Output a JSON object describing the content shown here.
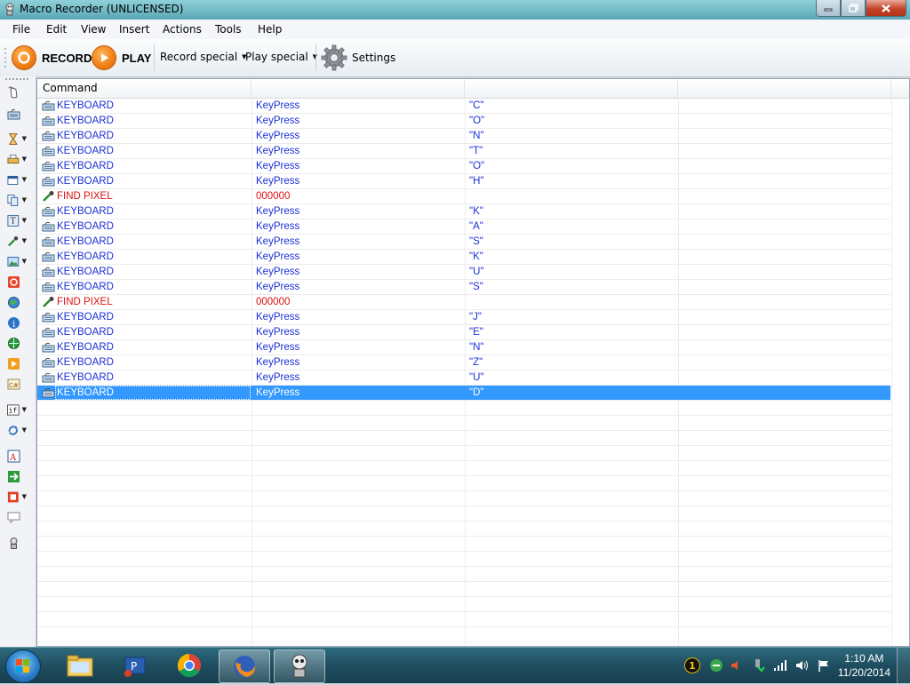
{
  "window": {
    "title": "Macro Recorder (UNLICENSED)"
  },
  "menu": [
    "File",
    "Edit",
    "View",
    "Insert",
    "Actions",
    "Tools",
    "Help"
  ],
  "toolbar": {
    "record_label": "RECORD",
    "play_label": "PLAY",
    "record_special_label": "Record special",
    "play_special_label": "Play special",
    "settings_label": "Settings"
  },
  "grid": {
    "header": {
      "command": "Command",
      "col2": "",
      "col3": "",
      "col4": ""
    },
    "rows": [
      {
        "type": "keyboard",
        "command": "KEYBOARD",
        "action": "KeyPress",
        "value": "\"C\""
      },
      {
        "type": "keyboard",
        "command": "KEYBOARD",
        "action": "KeyPress",
        "value": "\"O\""
      },
      {
        "type": "keyboard",
        "command": "KEYBOARD",
        "action": "KeyPress",
        "value": "\"N\""
      },
      {
        "type": "keyboard",
        "command": "KEYBOARD",
        "action": "KeyPress",
        "value": "\"T\""
      },
      {
        "type": "keyboard",
        "command": "KEYBOARD",
        "action": "KeyPress",
        "value": "\"O\""
      },
      {
        "type": "keyboard",
        "command": "KEYBOARD",
        "action": "KeyPress",
        "value": "\"H\""
      },
      {
        "type": "findpixel",
        "command": "FIND PIXEL",
        "action": "000000",
        "value": ""
      },
      {
        "type": "keyboard",
        "command": "KEYBOARD",
        "action": "KeyPress",
        "value": "\"K\""
      },
      {
        "type": "keyboard",
        "command": "KEYBOARD",
        "action": "KeyPress",
        "value": "\"A\""
      },
      {
        "type": "keyboard",
        "command": "KEYBOARD",
        "action": "KeyPress",
        "value": "\"S\""
      },
      {
        "type": "keyboard",
        "command": "KEYBOARD",
        "action": "KeyPress",
        "value": "\"K\""
      },
      {
        "type": "keyboard",
        "command": "KEYBOARD",
        "action": "KeyPress",
        "value": "\"U\""
      },
      {
        "type": "keyboard",
        "command": "KEYBOARD",
        "action": "KeyPress",
        "value": "\"S\""
      },
      {
        "type": "findpixel",
        "command": "FIND PIXEL",
        "action": "000000",
        "value": ""
      },
      {
        "type": "keyboard",
        "command": "KEYBOARD",
        "action": "KeyPress",
        "value": "\"J\""
      },
      {
        "type": "keyboard",
        "command": "KEYBOARD",
        "action": "KeyPress",
        "value": "\"E\""
      },
      {
        "type": "keyboard",
        "command": "KEYBOARD",
        "action": "KeyPress",
        "value": "\"N\""
      },
      {
        "type": "keyboard",
        "command": "KEYBOARD",
        "action": "KeyPress",
        "value": "\"Z\""
      },
      {
        "type": "keyboard",
        "command": "KEYBOARD",
        "action": "KeyPress",
        "value": "\"U\""
      },
      {
        "type": "keyboard",
        "command": "KEYBOARD",
        "action": "KeyPress",
        "value": "\"D\"",
        "selected": true
      }
    ]
  },
  "left_toolbar": [
    "mouse-icon",
    "keyboard-icon",
    "hourglass-icon",
    "printer-icon",
    "window-icon",
    "copy-icon",
    "text-icon",
    "eyedropper-icon",
    "image-icon",
    "stop-icon",
    "web-icon",
    "info-icon",
    "network-icon",
    "play-macro-icon",
    "csharp-icon",
    "if-icon",
    "loop-icon",
    "label-icon",
    "goto-icon",
    "block-icon",
    "comment-icon",
    "robot-icon"
  ],
  "taskbar": {
    "apps": [
      "explorer-icon",
      "powershell-icon",
      "chrome-icon",
      "firefox-icon",
      "macro-recorder-icon"
    ],
    "tray_badge": "1",
    "clock_time": "1:10 AM",
    "clock_date": "11/20/2014"
  }
}
